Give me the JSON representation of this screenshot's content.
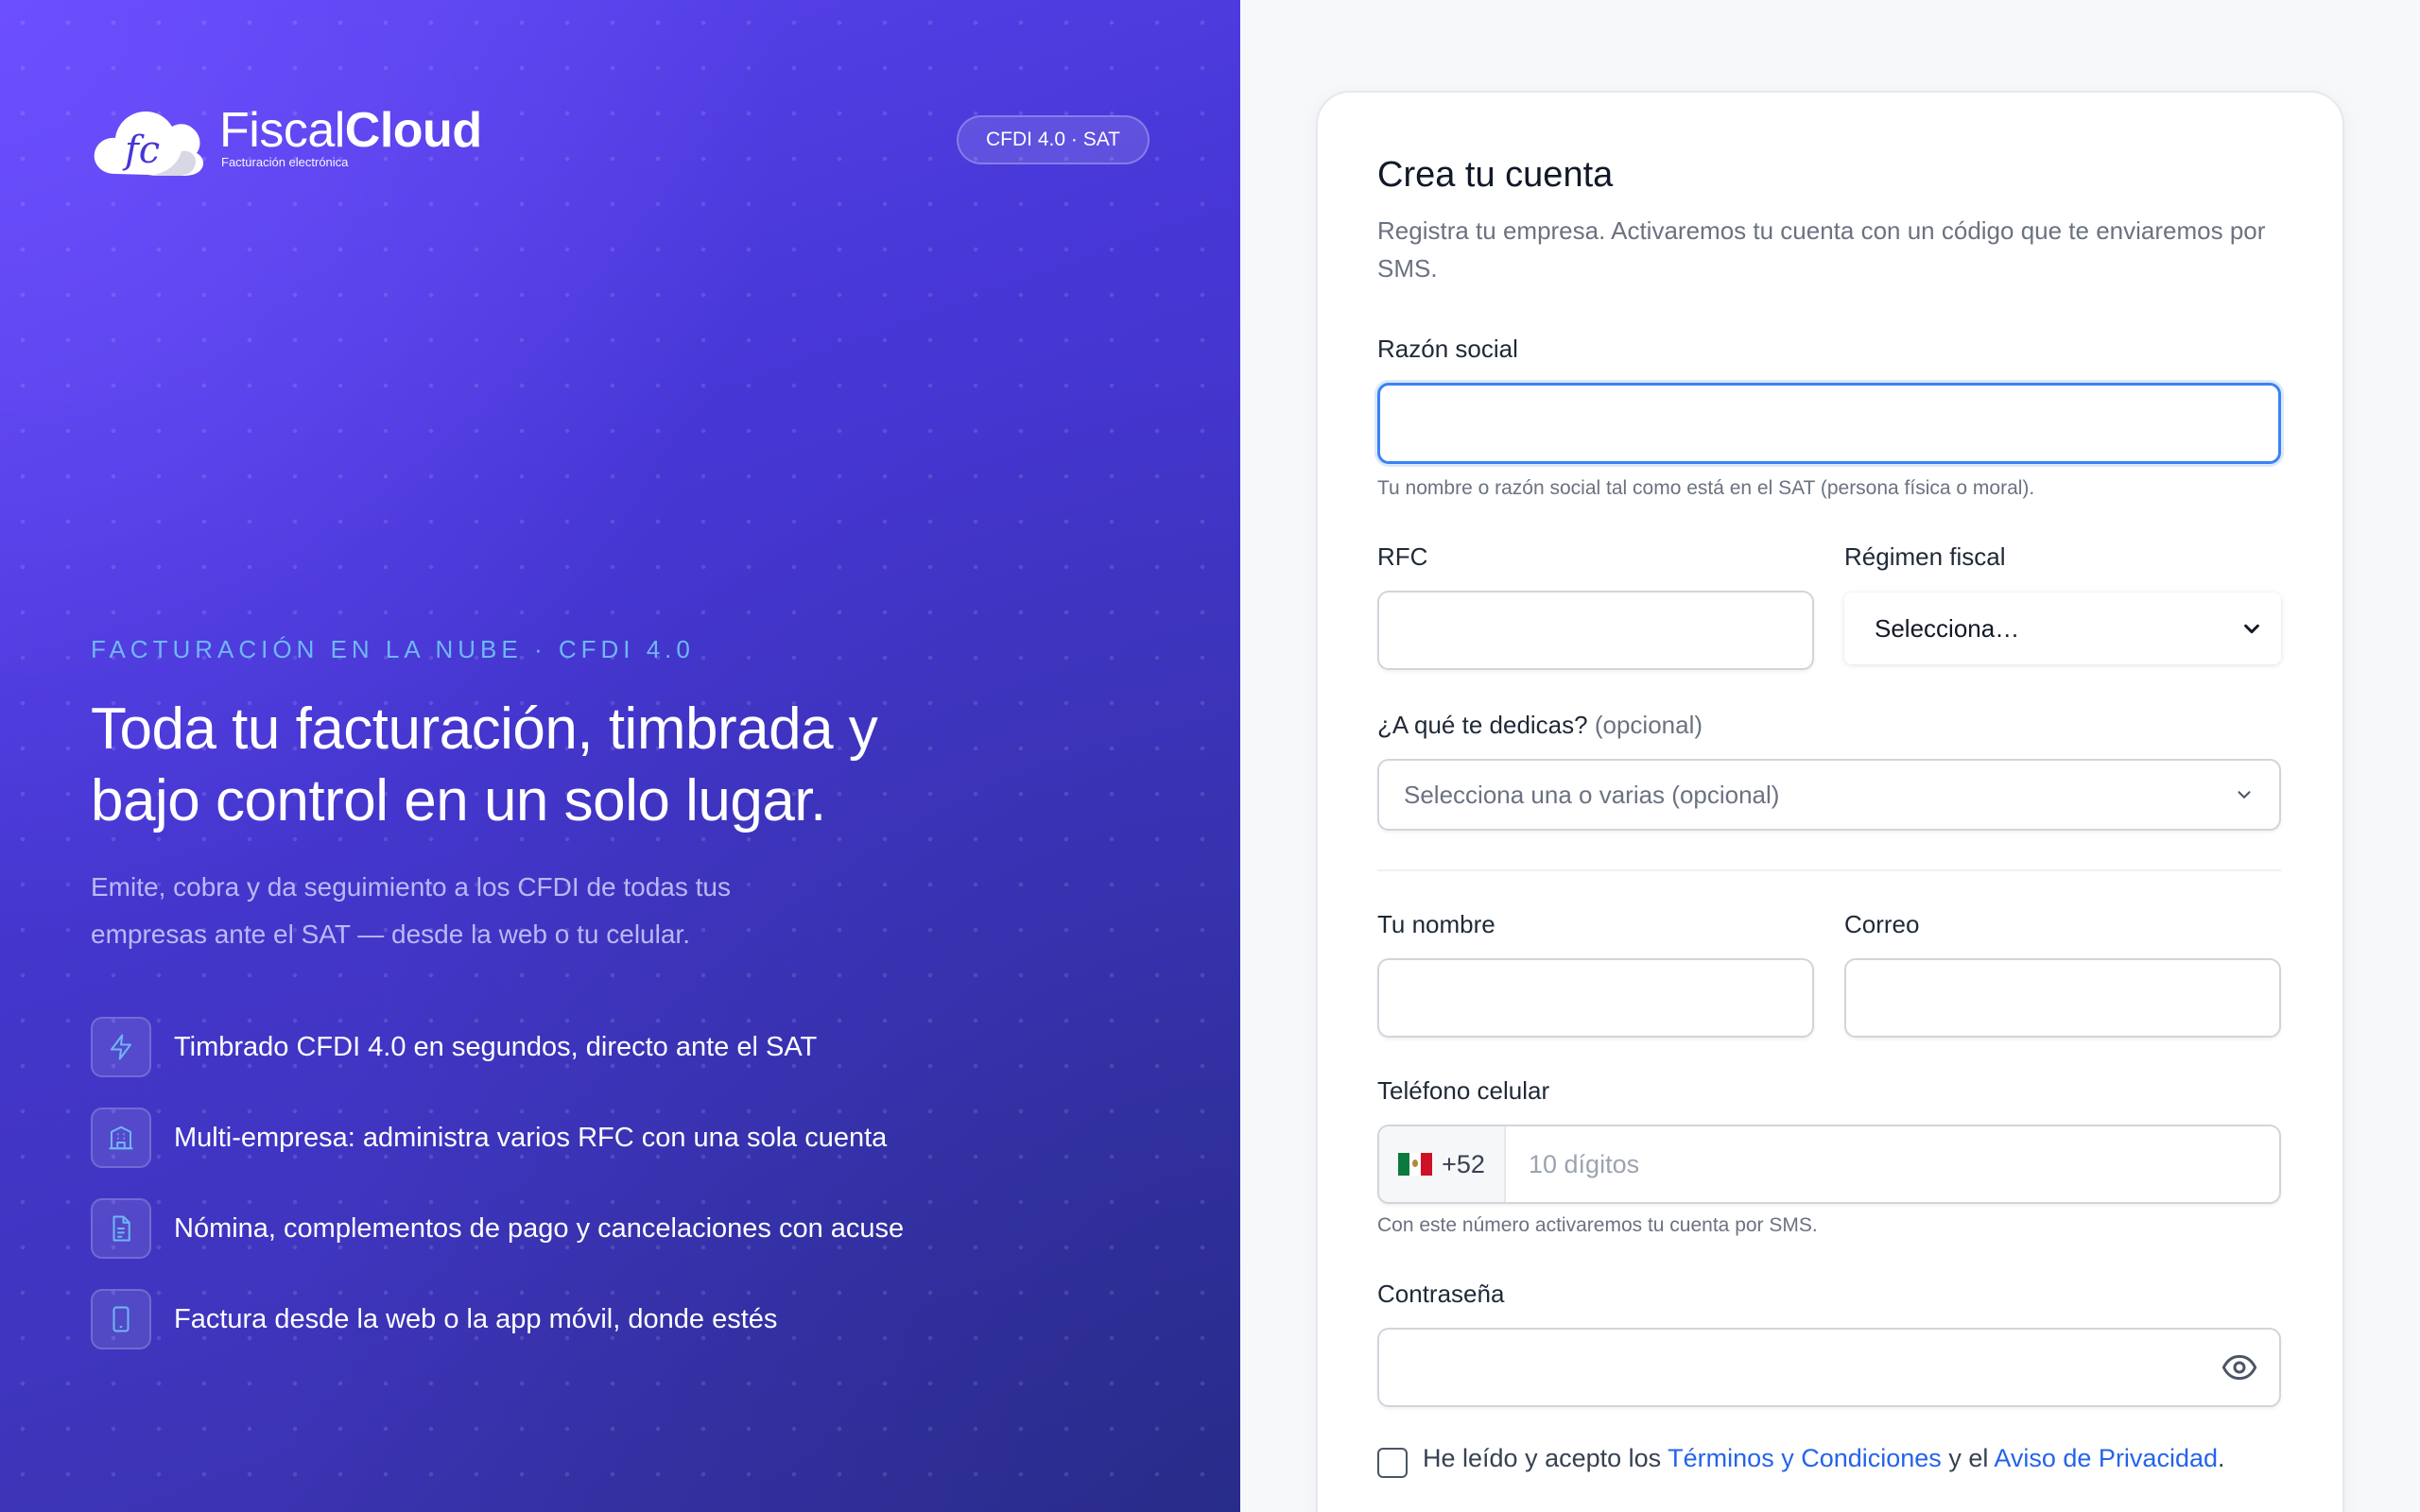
{
  "brand": {
    "name_light": "Fiscal",
    "name_bold": "Cloud",
    "monogram": "fc",
    "tagline": "Facturación electrónica",
    "badge": "CFDI 4.0 · SAT"
  },
  "hero": {
    "eyebrow": "FACTURACIÓN EN LA NUBE · CFDI 4.0",
    "headline_line1": "Toda tu facturación, timbrada y",
    "headline_line2": "bajo control en un solo lugar.",
    "subtext_line1": "Emite, cobra y da seguimiento a los CFDI de todas tus",
    "subtext_line2": "empresas ante el SAT — desde la web o tu celular.",
    "features": [
      {
        "icon": "lightning-icon",
        "label": "Timbrado CFDI 4.0 en segundos, directo ante el SAT"
      },
      {
        "icon": "building-icon",
        "label": "Multi-empresa: administra varios RFC con una sola cuenta"
      },
      {
        "icon": "document-icon",
        "label": "Nómina, complementos de pago y cancelaciones con acuse"
      },
      {
        "icon": "smartphone-icon",
        "label": "Factura desde la web o la app móvil, donde estés"
      }
    ],
    "colors": {
      "accent": "#6fb7f5",
      "gradient_start": "#5b45f0",
      "gradient_end": "#35309e"
    }
  },
  "form": {
    "title": "Crea tu cuenta",
    "subtitle": "Registra tu empresa. Activaremos tu cuenta con un código que te enviaremos por SMS.",
    "razon_social": {
      "label": "Razón social",
      "value": "",
      "hint": "Tu nombre o razón social tal como está en el SAT (persona física o moral)."
    },
    "rfc": {
      "label": "RFC",
      "value": ""
    },
    "regimen": {
      "label": "Régimen fiscal",
      "selected": "Selecciona…"
    },
    "dedicas": {
      "label": "¿A qué te dedicas?",
      "optional": "(opcional)",
      "placeholder": "Selecciona una o varias (opcional)"
    },
    "nombre": {
      "label": "Tu nombre",
      "value": ""
    },
    "correo": {
      "label": "Correo",
      "value": ""
    },
    "telefono": {
      "label": "Teléfono celular",
      "prefix": "+52",
      "placeholder": "10 dígitos",
      "hint": "Con este número activaremos tu cuenta por SMS."
    },
    "password": {
      "label": "Contraseña",
      "value": ""
    },
    "terms": {
      "prefix": "He leído y acepto los",
      "terms_link": "Términos y Condiciones",
      "middle": "y el",
      "privacy_link": "Aviso de Privacidad",
      "suffix": "."
    },
    "colors": {
      "focus": "#3b82f6",
      "link": "#2563eb"
    }
  }
}
